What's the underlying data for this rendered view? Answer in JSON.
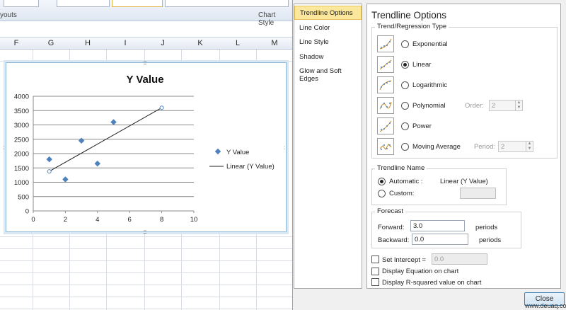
{
  "ribbon": {
    "group_left": "youts",
    "group_right": "Chart Style"
  },
  "columns": [
    "F",
    "G",
    "H",
    "I",
    "J",
    "K",
    "L",
    "M"
  ],
  "chart_data": {
    "type": "scatter",
    "title": "Y Value",
    "x_ticks": [
      "0",
      "2",
      "4",
      "6",
      "8",
      "10"
    ],
    "y_ticks": [
      "0",
      "500",
      "1000",
      "1500",
      "2000",
      "2500",
      "3000",
      "3500",
      "4000"
    ],
    "xlim": [
      0,
      10
    ],
    "ylim": [
      0,
      4000
    ],
    "series": [
      {
        "name": "Y Value",
        "x": [
          1,
          2,
          3,
          4,
          5
        ],
        "y": [
          1800,
          1100,
          2450,
          1650,
          3100
        ]
      }
    ],
    "trendline": {
      "name": "Linear (Y Value)",
      "x": [
        1,
        8
      ],
      "y": [
        1380,
        3600
      ]
    },
    "legend": "right",
    "grid": true
  },
  "nav": [
    "Trendline Options",
    "Line Color",
    "Line Style",
    "Shadow",
    "Glow and Soft Edges"
  ],
  "panel": {
    "title": "Trendline Options",
    "type_group": "Trend/Regression Type",
    "types": [
      {
        "label": "Exponential"
      },
      {
        "label": "Linear"
      },
      {
        "label": "Logarithmic"
      },
      {
        "label": "Polynomial"
      },
      {
        "label": "Power"
      },
      {
        "label": "Moving Average"
      }
    ],
    "order_label": "Order:",
    "order_value": "2",
    "period_label": "Period:",
    "period_value": "2",
    "name_group": "Trendline Name",
    "automatic_label": "Automatic :",
    "automatic_value": "Linear (Y Value)",
    "custom_label": "Custom:",
    "forecast_group": "Forecast",
    "forward_label": "Forward:",
    "forward_value": "3.0",
    "backward_label": "Backward:",
    "backward_value": "0.0",
    "periods_label": "periods",
    "intercept_label": "Set Intercept =",
    "intercept_value": "0.0",
    "eq_label": "Display Equation on chart",
    "r2_label": "Display R-squared value on chart",
    "close_label": "Close"
  },
  "watermark": "www.deuaq.com"
}
